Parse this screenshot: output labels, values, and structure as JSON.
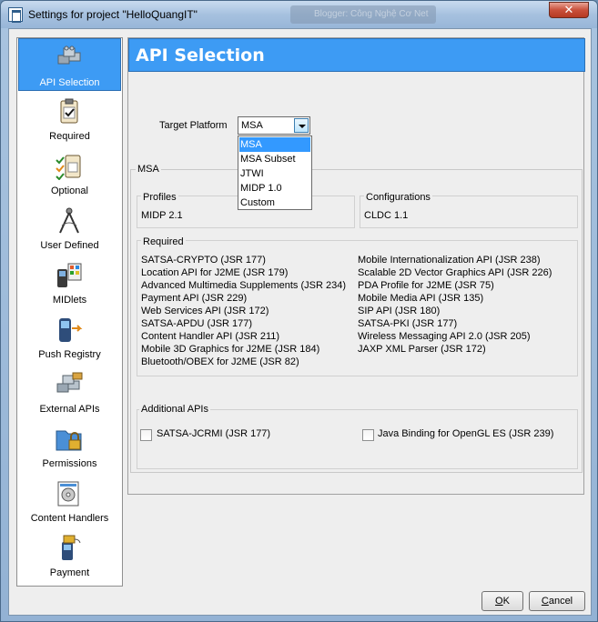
{
  "window": {
    "title": "Settings for project \"HelloQuangIT\"",
    "background_tab": "Blogger: Công Nghệ Cơ Net",
    "close_label": "✕"
  },
  "sidebar": {
    "items": [
      {
        "label": "API Selection",
        "icon": "puzzle-blocks-icon",
        "active": true
      },
      {
        "label": "Required",
        "icon": "clipboard-icon"
      },
      {
        "label": "Optional",
        "icon": "checklist-icon"
      },
      {
        "label": "User Defined",
        "icon": "compass-icon"
      },
      {
        "label": "MIDlets",
        "icon": "phone-apps-icon"
      },
      {
        "label": "Push Registry",
        "icon": "phone-push-icon"
      },
      {
        "label": "External APIs",
        "icon": "external-blocks-icon"
      },
      {
        "label": "Permissions",
        "icon": "folder-lock-icon"
      },
      {
        "label": "Content Handlers",
        "icon": "document-disc-icon"
      },
      {
        "label": "Payment",
        "icon": "phone-payment-icon"
      }
    ]
  },
  "main": {
    "header": "API Selection",
    "target_platform_label": "Target Platform",
    "target_platform_value": "MSA",
    "platform_options": [
      "MSA",
      "MSA Subset",
      "JTWI",
      "MIDP 1.0",
      "Custom"
    ],
    "group_title": "MSA",
    "profiles": {
      "title": "Profiles",
      "value": "MIDP 2.1"
    },
    "configurations": {
      "title": "Configurations",
      "value": "CLDC 1.1"
    },
    "required": {
      "title": "Required",
      "left": [
        "SATSA-CRYPTO (JSR 177)",
        "Location API for J2ME (JSR 179)",
        "Advanced Multimedia Supplements (JSR 234)",
        "Payment API (JSR 229)",
        "Web Services API (JSR 172)",
        "SATSA-APDU (JSR 177)",
        "Content Handler API (JSR 211)",
        "Mobile 3D Graphics for J2ME (JSR 184)",
        "Bluetooth/OBEX for J2ME (JSR 82)"
      ],
      "right": [
        "Mobile Internationalization API (JSR 238)",
        "Scalable 2D Vector Graphics API (JSR 226)",
        "PDA Profile for J2ME (JSR 75)",
        "Mobile Media API (JSR 135)",
        "SIP API (JSR 180)",
        "SATSA-PKI (JSR 177)",
        "Wireless Messaging API 2.0 (JSR 205)",
        "JAXP XML Parser (JSR 172)"
      ]
    },
    "additional": {
      "title": "Additional APIs",
      "items": [
        "SATSA-JCRMI (JSR 177)",
        "Java Binding for OpenGL ES (JSR 239)"
      ]
    }
  },
  "buttons": {
    "ok_mnemonic": "O",
    "ok_rest": "K",
    "cancel_mnemonic": "C",
    "cancel_rest": "ancel"
  },
  "colors": {
    "accent": "#3d9bf4",
    "selection": "#3399ff"
  }
}
